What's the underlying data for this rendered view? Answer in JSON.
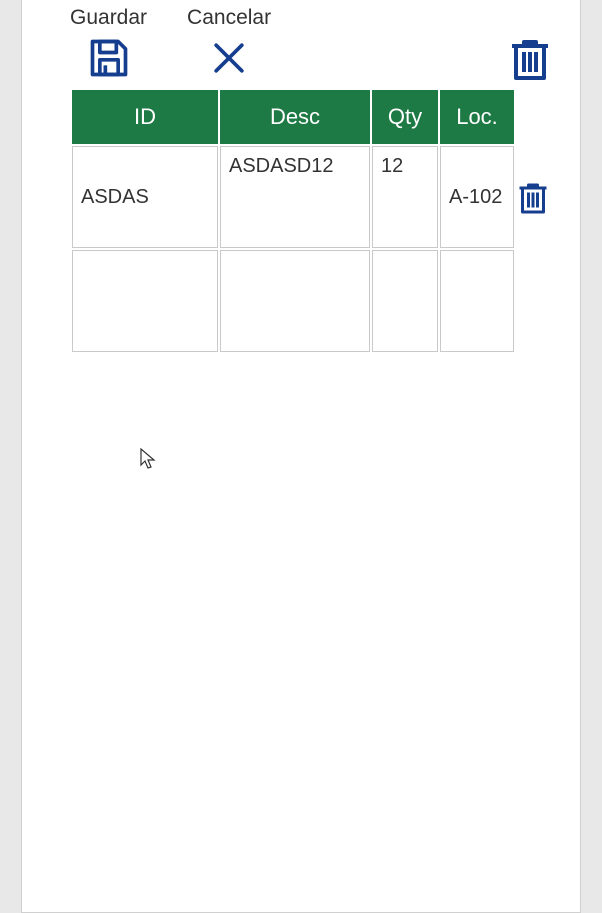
{
  "toolbar": {
    "save_label": "Guardar",
    "cancel_label": "Cancelar"
  },
  "columns": {
    "id": "ID",
    "desc": "Desc",
    "qty": "Qty",
    "loc": "Loc."
  },
  "rows": [
    {
      "id": "ASDAS",
      "desc": "ASDASD12",
      "qty": "12",
      "loc": "A-102"
    },
    {
      "id": "",
      "desc": "",
      "qty": "",
      "loc": ""
    }
  ],
  "colors": {
    "header_bg": "#1e7a44",
    "icon": "#163e8f"
  }
}
